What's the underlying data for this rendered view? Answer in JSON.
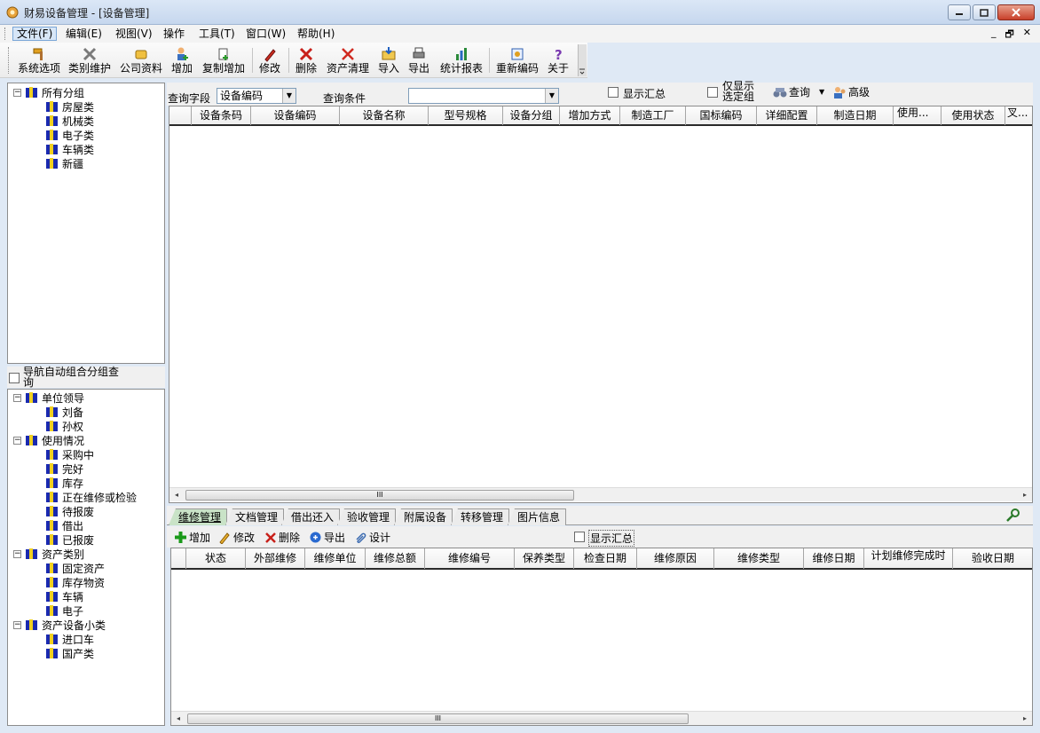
{
  "window": {
    "title": "财易设备管理 - [设备管理]"
  },
  "menu": {
    "items": [
      "文件(F)",
      "编辑(E)",
      "视图(V)",
      "操作",
      "工具(T)",
      "窗口(W)",
      "帮助(H)"
    ],
    "mdi": [
      "_",
      "🗗",
      "✕"
    ]
  },
  "toolbar": {
    "buttons": [
      "系统选项",
      "类别维护",
      "公司资料",
      "增加",
      "复制增加",
      "修改",
      "删除",
      "资产清理",
      "导入",
      "导出",
      "统计报表",
      "重新编码",
      "关于"
    ]
  },
  "tree_top": {
    "root": "所有分组",
    "children": [
      "房屋类",
      "机械类",
      "电子类",
      "车辆类",
      "新疆"
    ]
  },
  "nav_toggle": {
    "label_line1": "导航自动组合分组查",
    "label_line2": "询"
  },
  "tree_bottom": {
    "groups": [
      {
        "label": "单位领导",
        "children": [
          "刘备",
          "孙权"
        ]
      },
      {
        "label": "使用情况",
        "children": [
          "采购中",
          "完好",
          "库存",
          "正在维修或检验",
          "待报废",
          "借出",
          "已报废"
        ]
      },
      {
        "label": "资产类别",
        "children": [
          "固定资产",
          "库存物资",
          "车辆",
          "电子"
        ]
      },
      {
        "label": "资产设备小类",
        "children": [
          "进口车",
          "国产类"
        ]
      }
    ]
  },
  "query": {
    "field_label": "查询字段",
    "field_value": "设备编码",
    "condition_label": "查询条件",
    "condition_value": "",
    "show_summary": "显示汇总",
    "only_selected_line1": "仅显示",
    "only_selected_line2": "选定组",
    "query_button": "查询",
    "advanced_button": "高级"
  },
  "main_grid": {
    "columns": [
      "设备条码",
      "设备编码",
      "设备名称",
      "型号规格",
      "设备分组",
      "增加方式",
      "制造工厂",
      "国标编码",
      "详细配置",
      "制造日期",
      "使用...",
      "使用状态",
      "叉..."
    ]
  },
  "tabs": [
    "维修管理",
    "文档管理",
    "借出还入",
    "验收管理",
    "附属设备",
    "转移管理",
    "图片信息"
  ],
  "sub_toolbar": {
    "add": "增加",
    "edit": "修改",
    "delete": "删除",
    "export": "导出",
    "design": "设计",
    "show_summary": "显示汇总"
  },
  "sub_grid": {
    "columns": [
      "状态",
      "外部维修",
      "维修单位",
      "维修总额",
      "维修编号",
      "保养类型",
      "检查日期",
      "维修原因",
      "维修类型",
      "维修日期",
      "计划维修完成时",
      "验收日期"
    ]
  },
  "scroll": {
    "grip": "III",
    "left": "◂",
    "right": "▸"
  }
}
